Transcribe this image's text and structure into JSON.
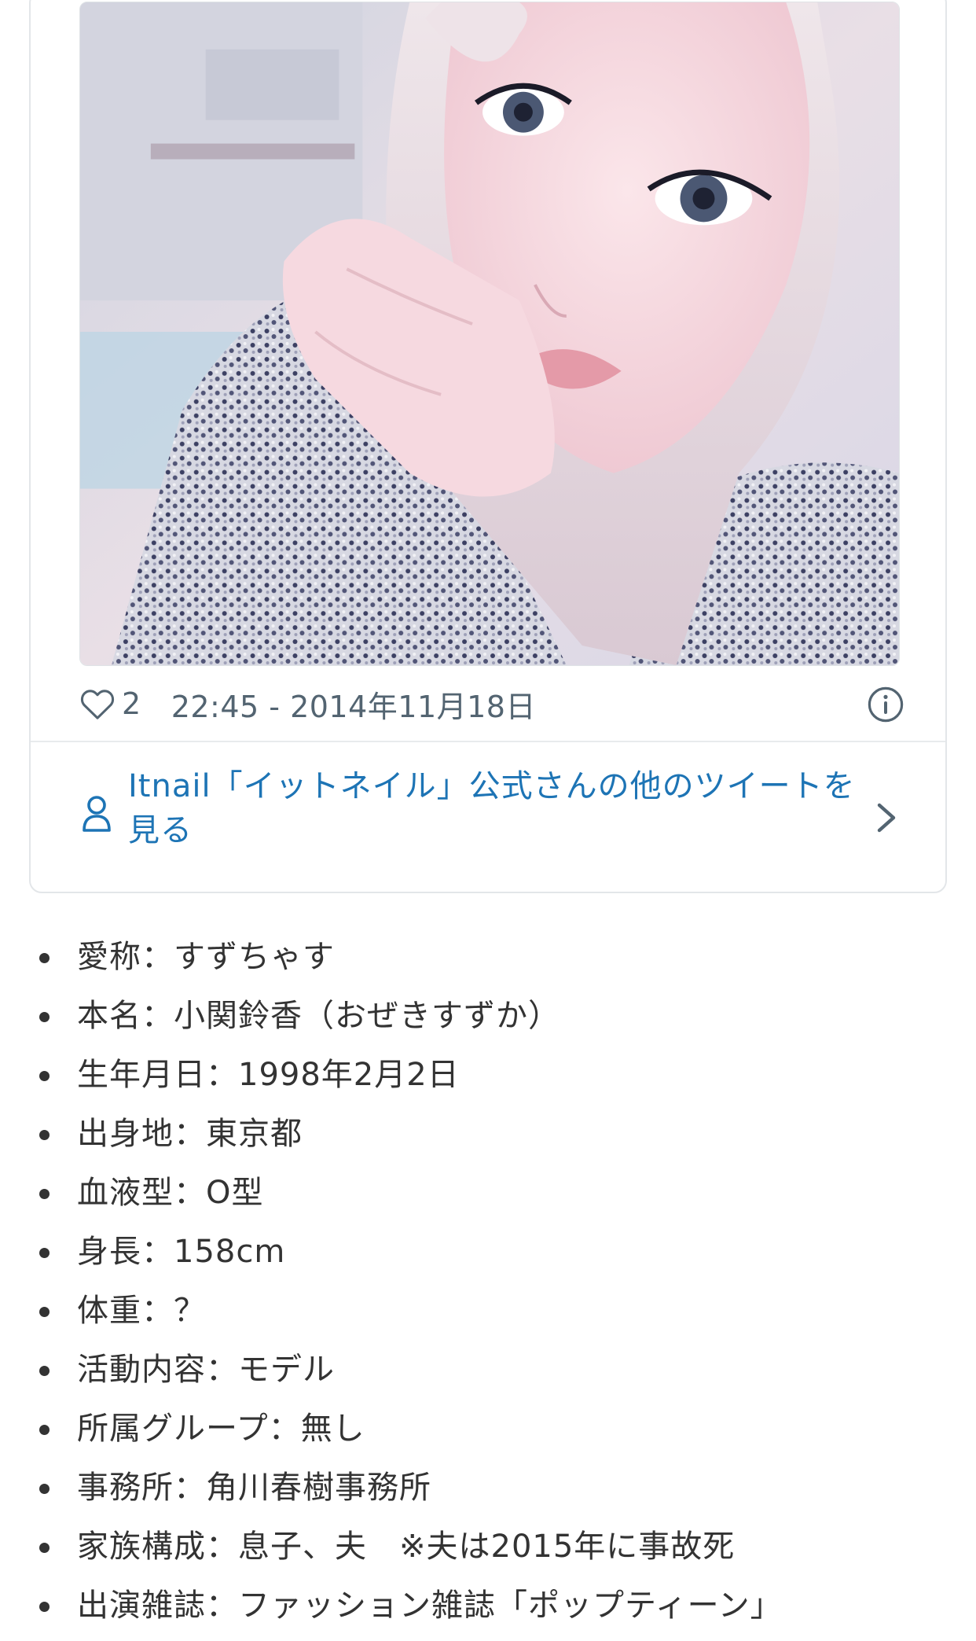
{
  "tweet": {
    "like_count": "2",
    "timestamp": "22:45 - 2014年11月18日",
    "more_tweets_label": "Itnail「イットネイル」公式さんの他のツイートを見る",
    "accent_color": "#1d74b5"
  },
  "profile": {
    "items": [
      "愛称：すずちゃす",
      "本名：小関鈴香（おぜきすずか）",
      "生年月日：1998年2月2日",
      "出身地：東京都",
      "血液型：O型",
      "身長：158cm",
      "体重：？",
      "活動内容：モデル",
      "所属グループ：無し",
      "事務所：角川春樹事務所",
      "家族構成：息子、夫　※夫は2015年に事故死",
      "出演雑誌：ファッション雑誌「ポップティーン」"
    ]
  }
}
